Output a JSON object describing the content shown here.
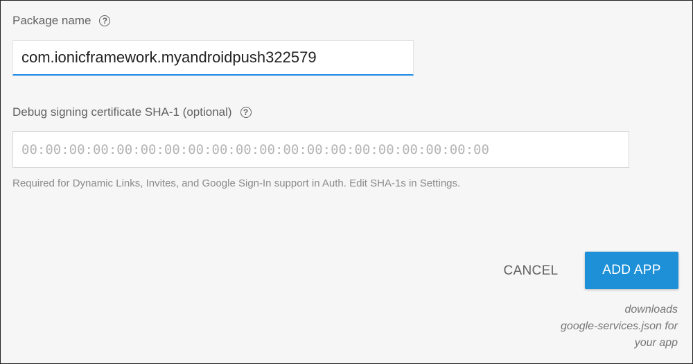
{
  "package": {
    "label": "Package name",
    "help_icon": "?",
    "value": "com.ionicframework.myandroidpush322579"
  },
  "sha": {
    "label": "Debug signing certificate SHA-1 (optional)",
    "help_icon": "?",
    "placeholder": "00:00:00:00:00:00:00:00:00:00:00:00:00:00:00:00:00:00:00:00",
    "hint": "Required for Dynamic Links, Invites, and Google Sign-In support in Auth. Edit SHA-1s in Settings."
  },
  "actions": {
    "cancel_label": "CANCEL",
    "add_label": "ADD APP"
  },
  "note": {
    "lines": [
      "downloads",
      "google-services.json for",
      "your app"
    ]
  },
  "colors": {
    "accent": "#1e90d8",
    "focus_underline": "#1e88e5",
    "background": "#f6f6f6"
  },
  "icons": {
    "help": "help-circle-icon"
  }
}
